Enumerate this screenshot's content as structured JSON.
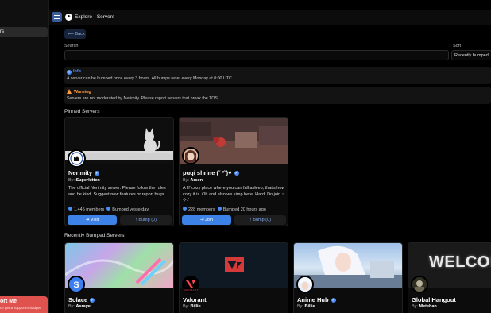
{
  "sidebar": {
    "selected_label": "rs",
    "promo_title": "ort Me",
    "promo_text": "ce get a supporter badge!"
  },
  "topbar": {
    "menu_icon": "hamburger-icon",
    "explore_icon": "compass-icon",
    "title": "Explore - Servers"
  },
  "back_label": "Back",
  "search": {
    "label": "Search",
    "value": ""
  },
  "sort": {
    "label": "Sort",
    "value": "Recently bumped"
  },
  "info": {
    "title": "Info",
    "text": "A server can be bumped once every 3 hours. All bumps reset every Monday at 0:00 UTC."
  },
  "warning": {
    "title": "Warning",
    "text": "Servers are not moderated by Nerimity. Please report servers that break the TOS."
  },
  "pinned_title": "Pinned Servers",
  "pinned": [
    {
      "name": "Nerimity",
      "by_prefix": "By:",
      "by": "Superkitten",
      "description": "The official Nerimity server. Please follow the rules and be kind. Suggest new features or report bugs.",
      "members": "1,445 members",
      "bumped": "Bumped yesterday",
      "primary_label": "Visit",
      "bump_label": "Bump (0)"
    },
    {
      "name": "puqi shrine (˘ ³˘)♥",
      "by_prefix": "By:",
      "by": "Arsen",
      "description": "A lil' cozy place where you can fall asleep, that's how cozy it is. Oh and also we simp here. Hard. Do join ~ ⊹.°",
      "members": "228 members",
      "bumped": "Bumped 20 hours ago",
      "primary_label": "Join",
      "bump_label": "Bump (0)"
    }
  ],
  "recent_title": "Recently Bumped Servers",
  "recent": [
    {
      "name": "Solace",
      "verified": true,
      "by_prefix": "By:",
      "by": "Asraye"
    },
    {
      "name": "Valorant",
      "verified": false,
      "by_prefix": "By:",
      "by": "Billie",
      "banner_logo": "VALORANT"
    },
    {
      "name": "Anime Hub",
      "verified": true,
      "by_prefix": "By:",
      "by": "Billie"
    },
    {
      "name": "Global Hangout",
      "verified": false,
      "by_prefix": "By:",
      "by": "Metehan",
      "banner_text": "WELCOM"
    }
  ],
  "colors": {
    "accent": "#3d82e6",
    "warning": "#ff9a3a",
    "promo": "#e0524d"
  }
}
